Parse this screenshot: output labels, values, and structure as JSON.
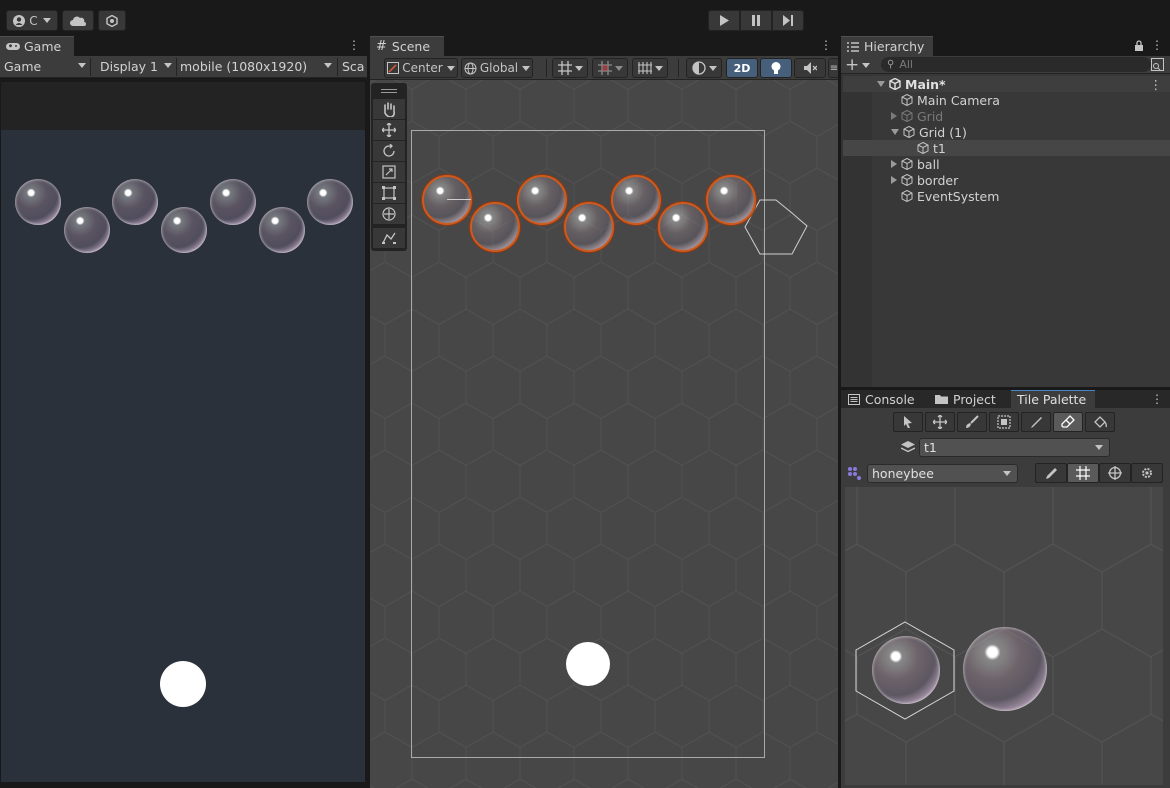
{
  "toolbar": {
    "account_label": "C",
    "icons": [
      "account-icon",
      "cloud-icon",
      "services-icon",
      "play-icon",
      "pause-icon",
      "step-icon"
    ]
  },
  "game_panel": {
    "tab_label": "Game",
    "mode_label": "Game",
    "display_label": "Display 1",
    "resolution_label": "mobile (1080x1920)",
    "scale_label": "Sca"
  },
  "scene_panel": {
    "tab_label": "Scene",
    "pivot_label": "Center",
    "space_label": "Global",
    "mode_2d_label": "2D"
  },
  "hierarchy_panel": {
    "tab_label": "Hierarchy",
    "search_placeholder": "All",
    "scene_name": "Main*",
    "items": [
      {
        "label": "Main Camera"
      },
      {
        "label": "Grid"
      },
      {
        "label": "Grid (1)"
      },
      {
        "label": "t1"
      },
      {
        "label": "ball"
      },
      {
        "label": "border"
      },
      {
        "label": "EventSystem"
      }
    ]
  },
  "bottom_panel": {
    "tabs": [
      {
        "label": "Console"
      },
      {
        "label": "Project"
      },
      {
        "label": "Tile Palette"
      }
    ],
    "active_tilemap": "t1",
    "palette_name": "honeybee"
  },
  "colors": {
    "editor_bg": "#191919",
    "panel_bg": "#3c3c3c",
    "scene_bg": "#474747",
    "game_bg": "#2b313b",
    "selection_orange": "#d05a1e",
    "active_blue": "#46607c"
  }
}
